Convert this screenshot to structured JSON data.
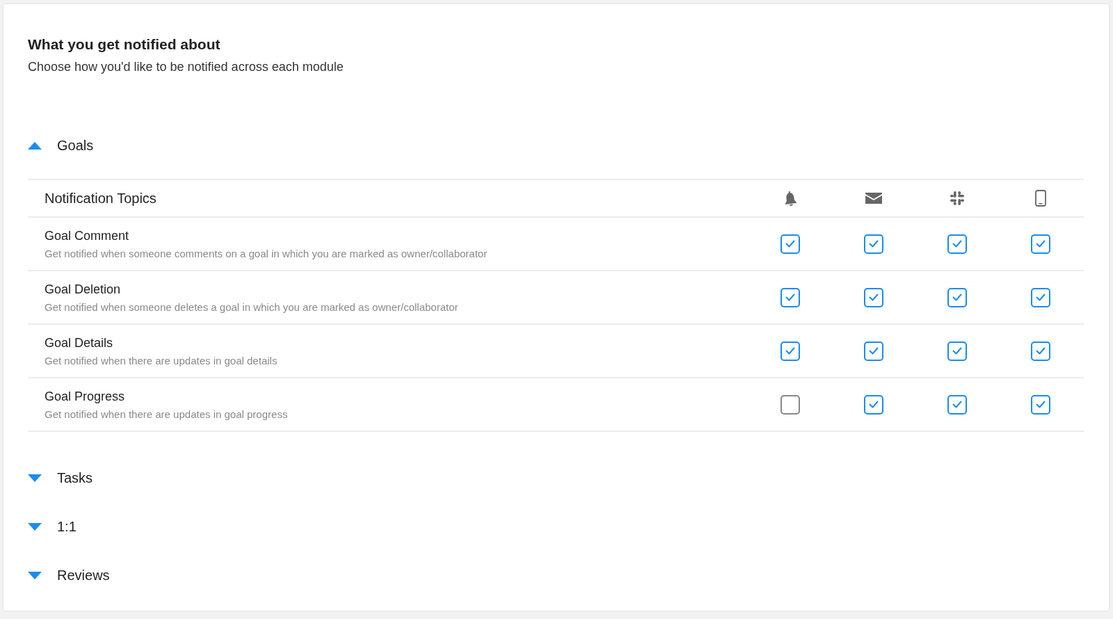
{
  "header": {
    "title": "What you get notified about",
    "subtitle": "Choose how you'd like to be notified across each module"
  },
  "sections": [
    {
      "label": "Goals",
      "expanded": true,
      "table": {
        "topics_heading": "Notification Topics",
        "channels": [
          {
            "kind": "bell"
          },
          {
            "kind": "mail"
          },
          {
            "kind": "slack"
          },
          {
            "kind": "phone"
          }
        ],
        "rows": [
          {
            "title": "Goal Comment",
            "description": "Get notified when someone comments on a goal in which you are marked as owner/collaborator",
            "checks": [
              {
                "checked": true
              },
              {
                "checked": true
              },
              {
                "checked": true
              },
              {
                "checked": true
              }
            ]
          },
          {
            "title": "Goal Deletion",
            "description": "Get notified when someone deletes a goal in which you are marked as owner/collaborator",
            "checks": [
              {
                "checked": true
              },
              {
                "checked": true
              },
              {
                "checked": true
              },
              {
                "checked": true
              }
            ]
          },
          {
            "title": "Goal Details",
            "description": "Get notified when there are updates in goal details",
            "checks": [
              {
                "checked": true
              },
              {
                "checked": true
              },
              {
                "checked": true
              },
              {
                "checked": true
              }
            ]
          },
          {
            "title": "Goal Progress",
            "description": "Get notified when there are updates in goal progress",
            "checks": [
              {
                "checked": false
              },
              {
                "checked": true
              },
              {
                "checked": true
              },
              {
                "checked": true
              }
            ]
          }
        ]
      }
    },
    {
      "label": "Tasks",
      "expanded": false
    },
    {
      "label": "1:1",
      "expanded": false
    },
    {
      "label": "Reviews",
      "expanded": false
    }
  ]
}
